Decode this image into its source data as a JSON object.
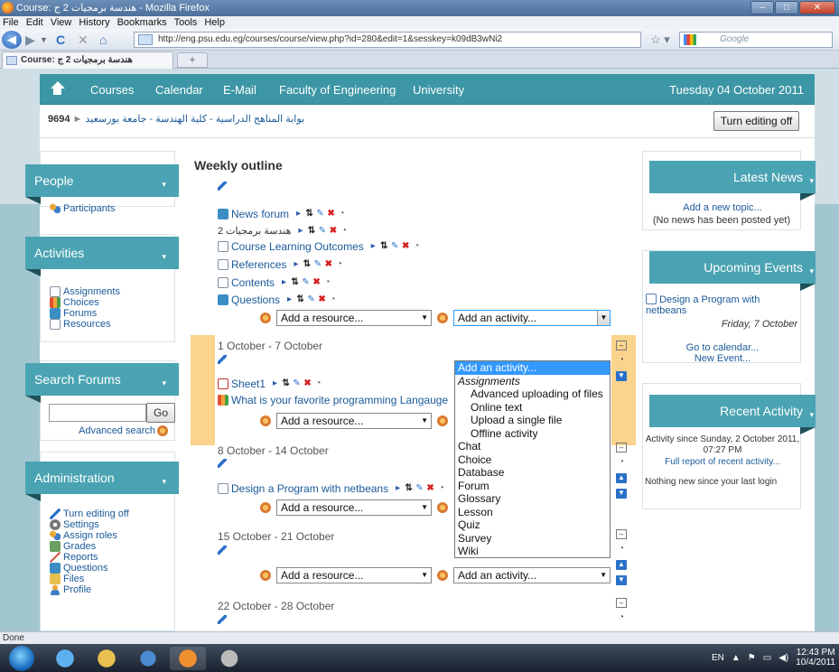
{
  "window": {
    "title": "Course: هندسة برمجيات 2 ج - Mozilla Firefox"
  },
  "menubar": [
    "File",
    "Edit",
    "View",
    "History",
    "Bookmarks",
    "Tools",
    "Help"
  ],
  "browser": {
    "url": "http://eng.psu.edu.eg/courses/course/view.php?id=280&edit=1&sesskey=k09dB3wNi2",
    "search_placeholder": "Google",
    "tab_title": "Course: هندسة برمجيات 2 ج",
    "new_tab": "+"
  },
  "topnav": {
    "items": [
      "Courses",
      "Calendar",
      "E-Mail",
      "Faculty of Engineering",
      "University"
    ],
    "date": "Tuesday 04 October 2011"
  },
  "breadcrumb": {
    "id": "9694",
    "sep": "►",
    "arabic": "بوابة المناهج الدراسية - كلية الهندسة - جامعة بورسعيد"
  },
  "edit_button": "Turn editing off",
  "blocks": {
    "people": {
      "title": "People",
      "items": [
        "Participants"
      ]
    },
    "activities": {
      "title": "Activities",
      "items": [
        "Assignments",
        "Choices",
        "Forums",
        "Resources"
      ]
    },
    "search": {
      "title": "Search Forums",
      "go": "Go",
      "advanced": "Advanced search"
    },
    "admin": {
      "title": "Administration",
      "items": [
        "Turn editing off",
        "Settings",
        "Assign roles",
        "Grades",
        "Reports",
        "Questions",
        "Files",
        "Profile"
      ]
    },
    "news": {
      "title": "Latest News",
      "add": "Add a new topic...",
      "none": "(No news has been posted yet)"
    },
    "events": {
      "title": "Upcoming Events",
      "event": "Design a Program with netbeans",
      "event_date": "Friday, 7 October",
      "calendar": "Go to calendar...",
      "new_event": "New Event..."
    },
    "recent": {
      "title": "Recent Activity",
      "since": "Activity since Sunday, 2 October 2011, 07:27 PM",
      "full": "Full report of recent activity...",
      "nothing": "Nothing new since your last login"
    }
  },
  "course": {
    "heading": "Weekly outline",
    "section0": {
      "items": [
        "News forum",
        "هندسة برمجيات 2",
        "Course Learning Outcomes",
        "References",
        "Contents",
        "Questions"
      ]
    },
    "weeks": [
      {
        "title": "1 October - 7 October",
        "items": [
          "Sheet1",
          "What is your favorite programming Langauge"
        ]
      },
      {
        "title": "8 October - 14 October",
        "items": [
          "Design a Program with netbeans"
        ]
      },
      {
        "title": "15 October - 21 October",
        "items": []
      },
      {
        "title": "22 October - 28 October",
        "items": []
      }
    ],
    "add_resource": "Add a resource...",
    "add_activity": "Add an activity..."
  },
  "dropdown": [
    "Add an activity...",
    "Assignments",
    "Advanced uploading of files",
    "Online text",
    "Upload a single file",
    "Offline activity",
    "Chat",
    "Choice",
    "Database",
    "Forum",
    "Glossary",
    "Lesson",
    "Quiz",
    "Survey",
    "Wiki"
  ],
  "status": "Done",
  "tray": {
    "lang": "EN",
    "time": "12:43 PM",
    "date": "10/4/2011"
  }
}
